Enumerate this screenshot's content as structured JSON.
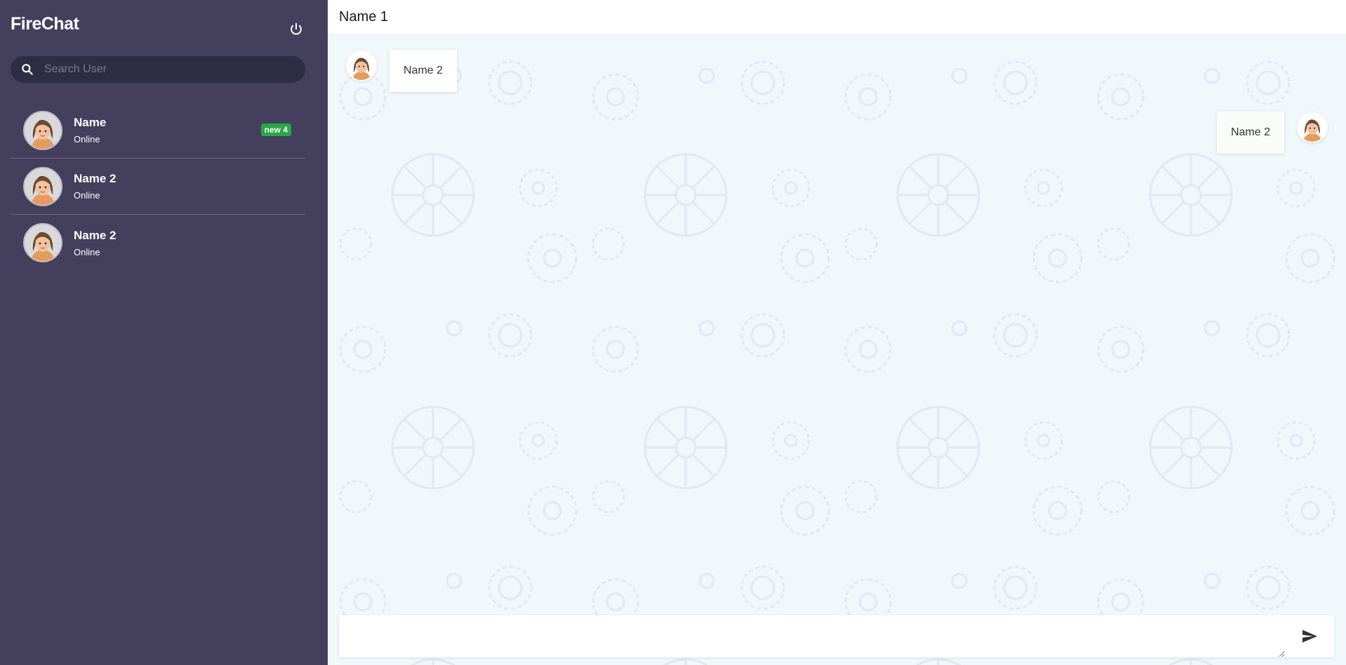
{
  "sidebar": {
    "brand": "FireChat",
    "search": {
      "placeholder": "Search User",
      "value": ""
    },
    "users": [
      {
        "name": "Name",
        "status": "Online",
        "badge": "new 4"
      },
      {
        "name": "Name 2",
        "status": "Online"
      },
      {
        "name": "Name 2",
        "status": "Online"
      }
    ]
  },
  "chat": {
    "title": "Name 1",
    "messages": [
      {
        "text": "Name 2",
        "side": "left"
      },
      {
        "text": "Name 2",
        "side": "right"
      }
    ],
    "composer": {
      "value": "",
      "placeholder": ""
    }
  },
  "colors": {
    "sidebar_bg": "#433f5c",
    "search_bg": "#2f2c45",
    "chat_bg": "#f1f8fc",
    "badge_green": "#28a745"
  },
  "icons": [
    "power-icon",
    "search-icon",
    "avatar-icon",
    "send-icon"
  ]
}
